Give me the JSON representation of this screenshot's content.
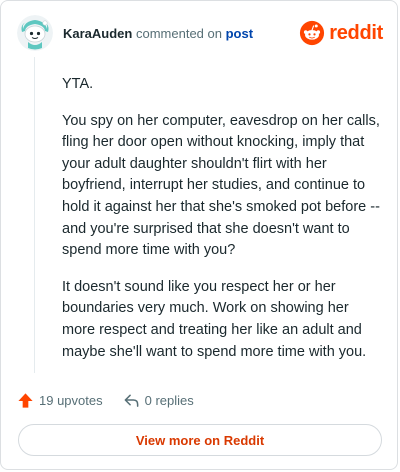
{
  "header": {
    "username": "KaraAuden",
    "action_text": "commented on",
    "post_link": "post",
    "brand": "reddit"
  },
  "comment": {
    "paragraphs": [
      "YTA.",
      "You spy on her computer, eavesdrop on her calls, fling her door open without knocking, imply that your adult daughter shouldn't flirt with her boyfriend, interrupt her studies, and continue to hold it against her that she's smoked pot before -- and you're surprised that she doesn't want to spend more time with you?",
      "It doesn't sound like you respect her or her boundaries very much. Work on showing her more respect and treating her like an adult and maybe she'll want to spend more time with you."
    ]
  },
  "actions": {
    "upvotes": "19 upvotes",
    "replies": "0 replies"
  },
  "footer": {
    "view_more": "View more on Reddit"
  },
  "colors": {
    "brand": "#ff4500",
    "link": "#0045ac",
    "view_more": "#d93900",
    "upvote_icon": "#ff4500"
  },
  "icons": {
    "avatar": "snoo-avatar",
    "brand": "reddit-logo-icon",
    "upvote": "upvote-arrow-icon",
    "reply": "reply-arrow-icon"
  }
}
